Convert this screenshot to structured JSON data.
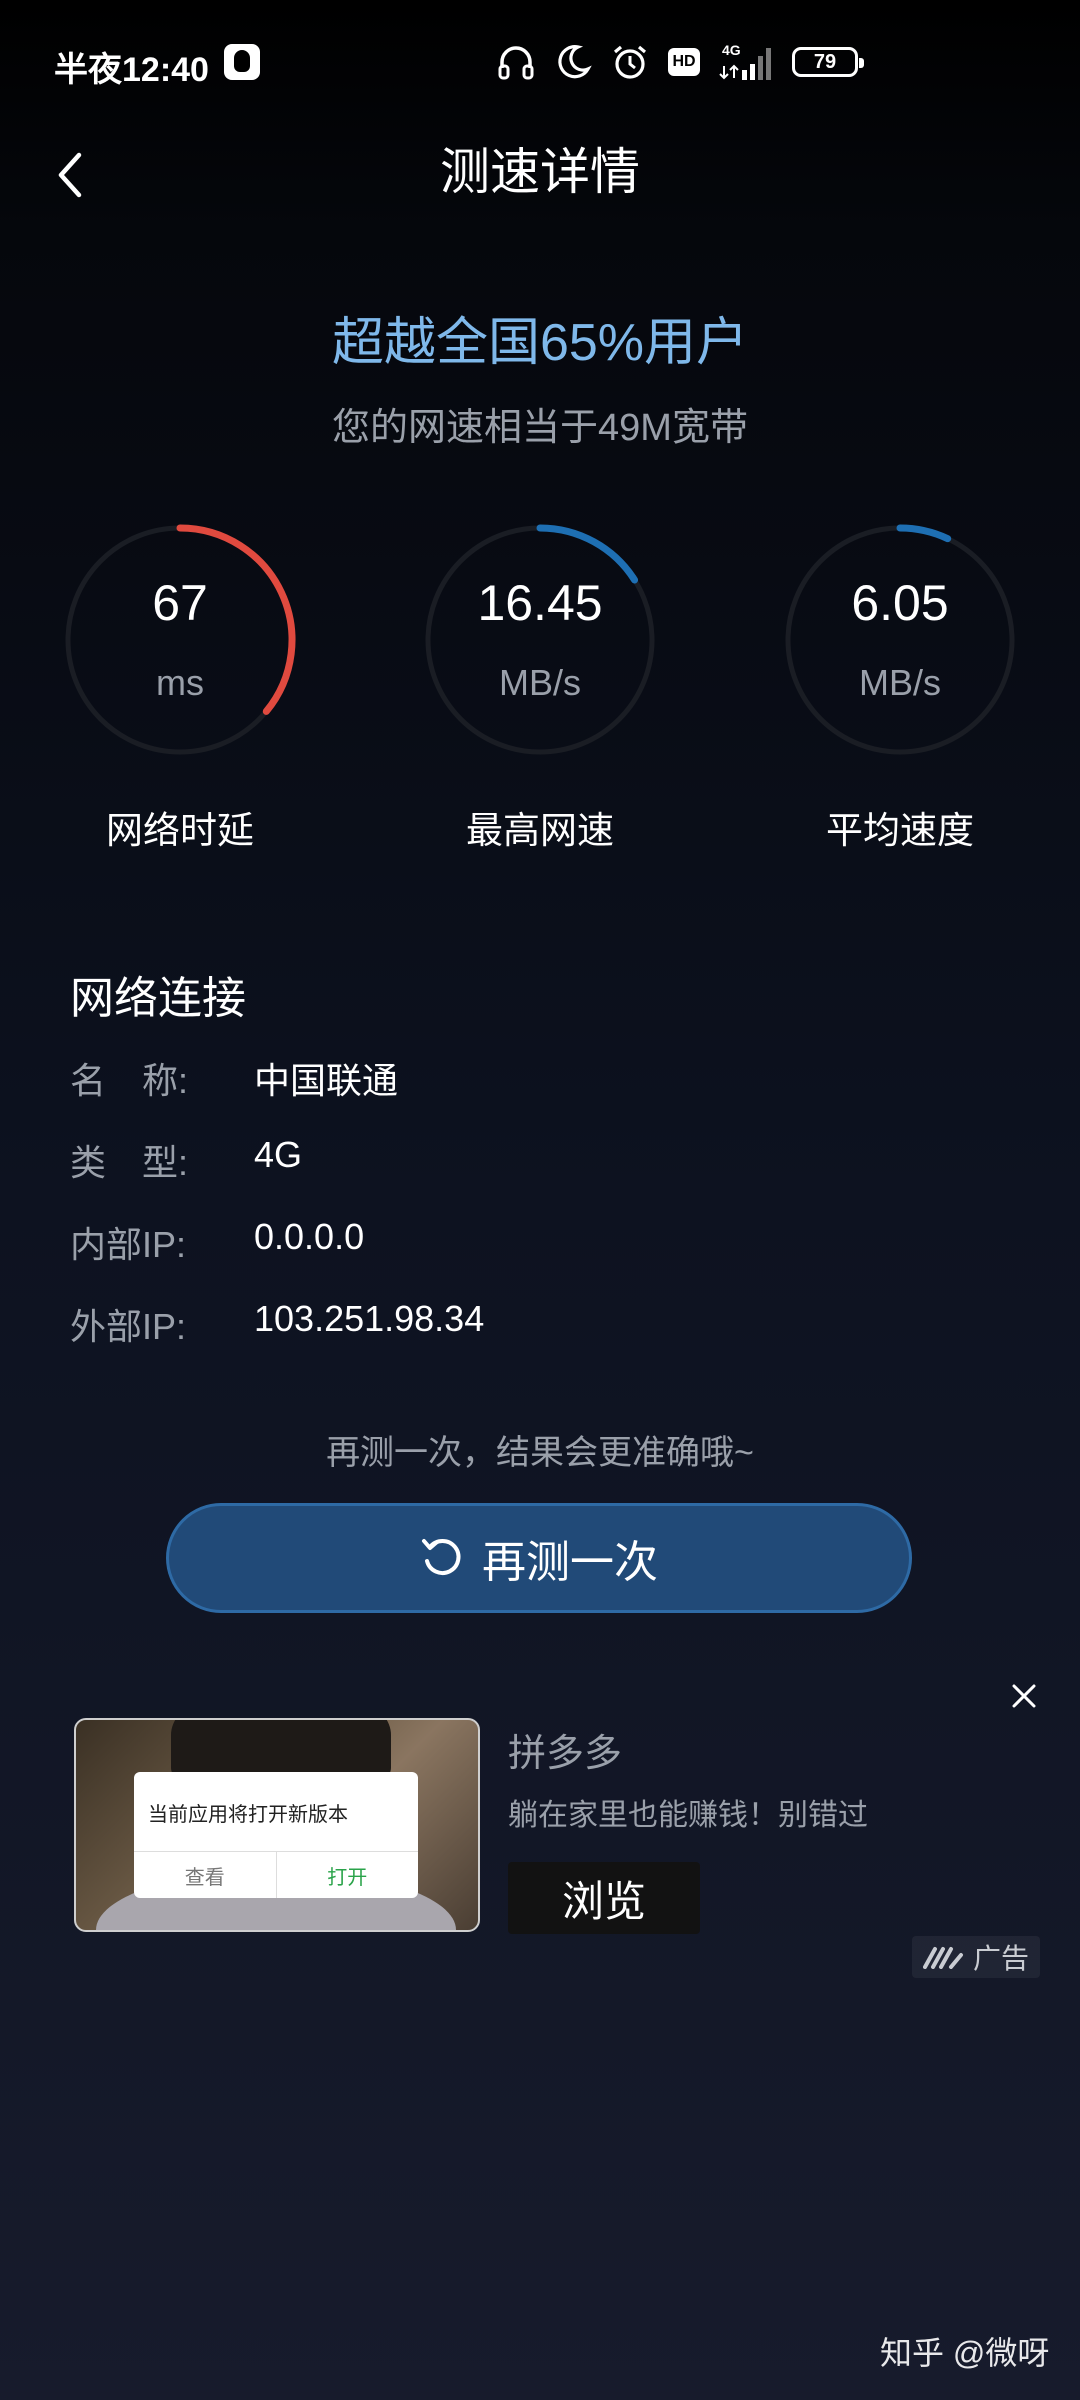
{
  "status_bar": {
    "time": "半夜12:40",
    "network": "4G",
    "hd": "HD",
    "battery": "79"
  },
  "header": {
    "title": "测速详情"
  },
  "summary": {
    "headline": "超越全国65%用户",
    "subline": "您的网速相当于49M宽带",
    "percentile": 65
  },
  "gauges": [
    {
      "value": "67",
      "unit": "ms",
      "label": "网络时延",
      "fill": 0.36,
      "color": "#e04a3f"
    },
    {
      "value": "16.45",
      "unit": "MB/s",
      "label": "最高网速",
      "fill": 0.16,
      "color": "#1e6fb3"
    },
    {
      "value": "6.05",
      "unit": "MB/s",
      "label": "平均速度",
      "fill": 0.07,
      "color": "#1e6fb3"
    }
  ],
  "network": {
    "section_title": "网络连接",
    "rows": [
      {
        "key": "名　称:",
        "value": "中国联通"
      },
      {
        "key": "类　型:",
        "value": "4G"
      },
      {
        "key": "内部IP:",
        "value": "0.0.0.0"
      },
      {
        "key": "外部IP:",
        "value": "103.251.98.34"
      }
    ]
  },
  "retest": {
    "hint": "再测一次，结果会更准确哦~",
    "button_label": "再测一次"
  },
  "ad": {
    "dialog_text": "当前应用将打开新版本",
    "dialog_left": "查看",
    "dialog_right": "打开",
    "brand": "拼多多",
    "description": "躺在家里也能赚钱！别错过",
    "cta": "浏览",
    "tag": "广告"
  },
  "watermark": "知乎 @微呀"
}
